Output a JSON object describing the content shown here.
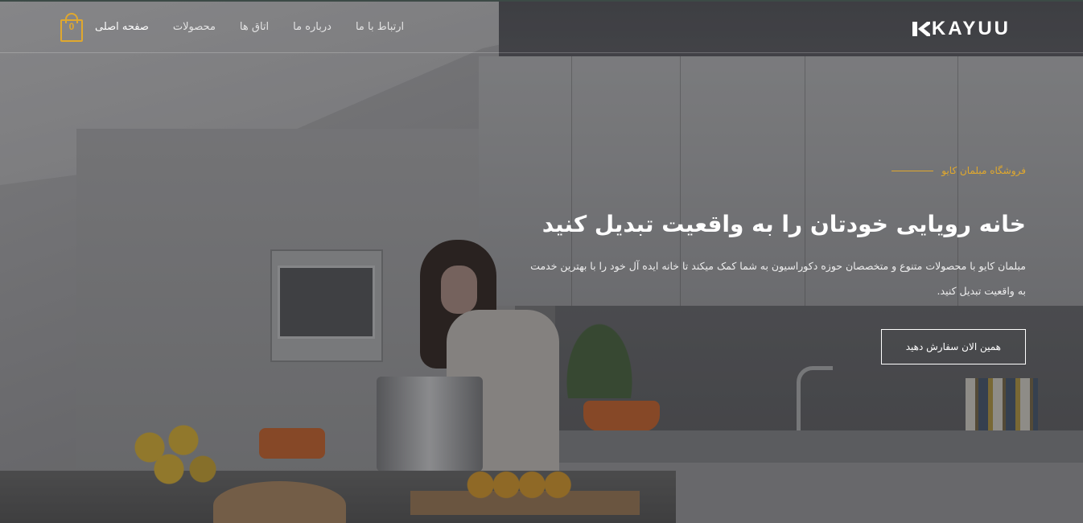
{
  "brand": {
    "name": "KAYUU",
    "logo_icon": "kayuu-k-mark-icon"
  },
  "nav": {
    "items": [
      {
        "label": "صفحه اصلی",
        "active": true
      },
      {
        "label": "محصولات",
        "active": false
      },
      {
        "label": "اتاق ها",
        "active": false
      },
      {
        "label": "درباره ما",
        "active": false
      },
      {
        "label": "ارتباط با ما",
        "active": false
      }
    ]
  },
  "cart": {
    "count": "0",
    "icon": "shopping-bag-icon"
  },
  "hero": {
    "eyebrow": "فروشگاه مبلمان کایو",
    "title": "خانه رویایی خودتان را به واقعیت تبدیل کنید",
    "description": "مبلمان کایو با محصولات متنوع و متخصصان حوزه دکوراسیون به شما کمک میکند تا خانه ایده آل خود را با بهترین خدمت به واقعیت تبدیل کنید.",
    "cta_label": "همین الان سفارش دهید"
  },
  "colors": {
    "accent": "#e0a82e",
    "text": "#ffffff"
  }
}
